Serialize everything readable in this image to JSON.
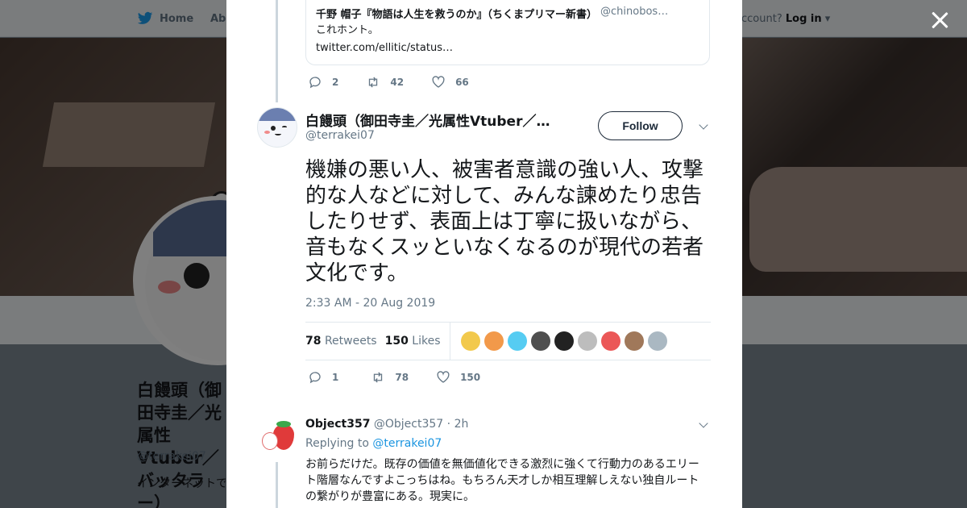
{
  "topbar": {
    "home_label": "Home",
    "about_label": "Abo",
    "account_prompt": "ccount?",
    "login_label": "Log in"
  },
  "profile": {
    "name_partial": "白饅頭（御田寺圭／光属性Vtuber／バッタラー）",
    "handle": "@terrakei07",
    "bio_partial": "インターネットで出したり、ラジオ"
  },
  "quoted_tweet": {
    "author_name": "千野 帽子『物語は人生を救うのか』（ちくまプリマー新書）",
    "author_handle": "@chinobos…",
    "text": "これホント。",
    "link": "twitter.com/ellitic/status…"
  },
  "quoted_actions": {
    "replies": "2",
    "retweets": "42",
    "likes": "66"
  },
  "main_tweet": {
    "author_name": "白饅頭（御田寺圭／光属性Vtuber／…",
    "author_handle": "@terrakei07",
    "follow_label": "Follow",
    "text": "機嫌の悪い人、被害者意識の強い人、攻撃的な人などに対して、みんな諫めたり忠告したりせず、表面上は丁寧に扱いながら、音もなくスッといなくなるのが現代の若者文化です。",
    "timestamp": "2:33 AM - 20 Aug 2019",
    "retweet_count": "78",
    "retweet_label": "Retweets",
    "like_count": "150",
    "like_label": "Likes",
    "liker_colors": [
      "#f2c94c",
      "#f2994a",
      "#56ccf2",
      "#4f4f4f",
      "#222222",
      "#bdbdbd",
      "#eb5757",
      "#a0785a",
      "#aab8c2"
    ]
  },
  "main_actions": {
    "replies": "1",
    "retweets": "78",
    "likes": "150"
  },
  "reply": {
    "author_name": "Object357",
    "author_handle": "@Object357",
    "time": "· 2h",
    "replying_prefix": "Replying to",
    "replying_to": "@terrakei07",
    "text": "お前らだけだ。既存の価値を無価値化できる激烈に強くて行動力のあるエリート階層なんですよこっちはね。もちろん天才しか相互理解しえない独自ルートの繋がりが豊富にある。現実に。"
  }
}
